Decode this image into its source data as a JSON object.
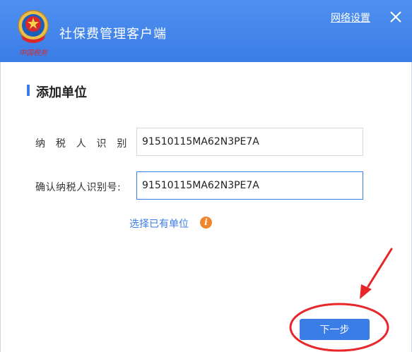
{
  "header": {
    "app_title": "社保费管理客户端",
    "network_settings_label": "网络设置",
    "logo_text": "中国税务",
    "background_color": "#3a7de6",
    "close_icon": "close-icon"
  },
  "section": {
    "title": "添加单位",
    "accent_color": "#3a7de6"
  },
  "form": {
    "taxpayer_id_label": "纳 税 人 识 别 号:",
    "taxpayer_id_value": "91510115MA62N3PE7A",
    "confirm_taxpayer_id_label": "确认纳税人识别号:",
    "confirm_taxpayer_id_value": "91510115MA62N3PE7A"
  },
  "choose_existing_label": "选择已有单位",
  "info_icon_glyph": "i",
  "info_icon_color": "#f0862e",
  "next_button_label": "下一步",
  "annotation_color": "#e8262a"
}
